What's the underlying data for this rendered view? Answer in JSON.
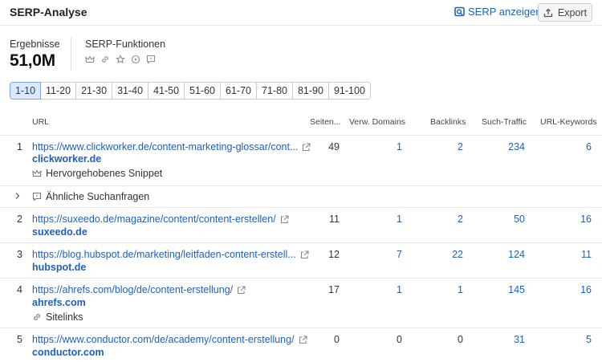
{
  "header": {
    "title": "SERP-Analyse",
    "serp_link": "SERP anzeigen",
    "export": "Export"
  },
  "stats": {
    "results_label": "Ergebnisse",
    "results_value": "51,0M",
    "features_label": "SERP-Funktionen"
  },
  "pager": [
    "1-10",
    "11-20",
    "21-30",
    "31-40",
    "41-50",
    "51-60",
    "61-70",
    "71-80",
    "81-90",
    "91-100"
  ],
  "columns": {
    "url": "URL",
    "seiten": "Seiten...",
    "domains": "Verw. Domains",
    "backlinks": "Backlinks",
    "traffic": "Such-Traffic",
    "keywords": "URL-Keywords"
  },
  "rows": [
    {
      "rank": "1",
      "url": "https://www.clickworker.de/content-marketing-glossar/cont...",
      "domain": "clickworker.de",
      "feature": "Hervorgehobenes Snippet",
      "seiten": "49",
      "domains": "1",
      "backlinks": "2",
      "traffic": "234",
      "keywords": "6"
    },
    {
      "rank": "2",
      "url": "https://suxeedo.de/magazine/content/content-erstellen/",
      "domain": "suxeedo.de",
      "seiten": "11",
      "domains": "1",
      "backlinks": "2",
      "traffic": "50",
      "keywords": "16"
    },
    {
      "rank": "3",
      "url": "https://blog.hubspot.de/marketing/leitfaden-content-erstell...",
      "domain": "hubspot.de",
      "seiten": "12",
      "domains": "7",
      "backlinks": "22",
      "traffic": "124",
      "keywords": "11"
    },
    {
      "rank": "4",
      "url": "https://ahrefs.com/blog/de/content-erstellung/",
      "domain": "ahrefs.com",
      "feature": "Sitelinks",
      "seiten": "17",
      "domains": "1",
      "backlinks": "1",
      "traffic": "145",
      "keywords": "16"
    },
    {
      "rank": "5",
      "url": "https://www.conductor.com/de/academy/content-erstellung/",
      "domain": "conductor.com",
      "seiten": "0",
      "domains": "0",
      "backlinks": "0",
      "traffic": "31",
      "keywords": "5"
    }
  ],
  "similar_queries": "Ähnliche Suchanfragen"
}
